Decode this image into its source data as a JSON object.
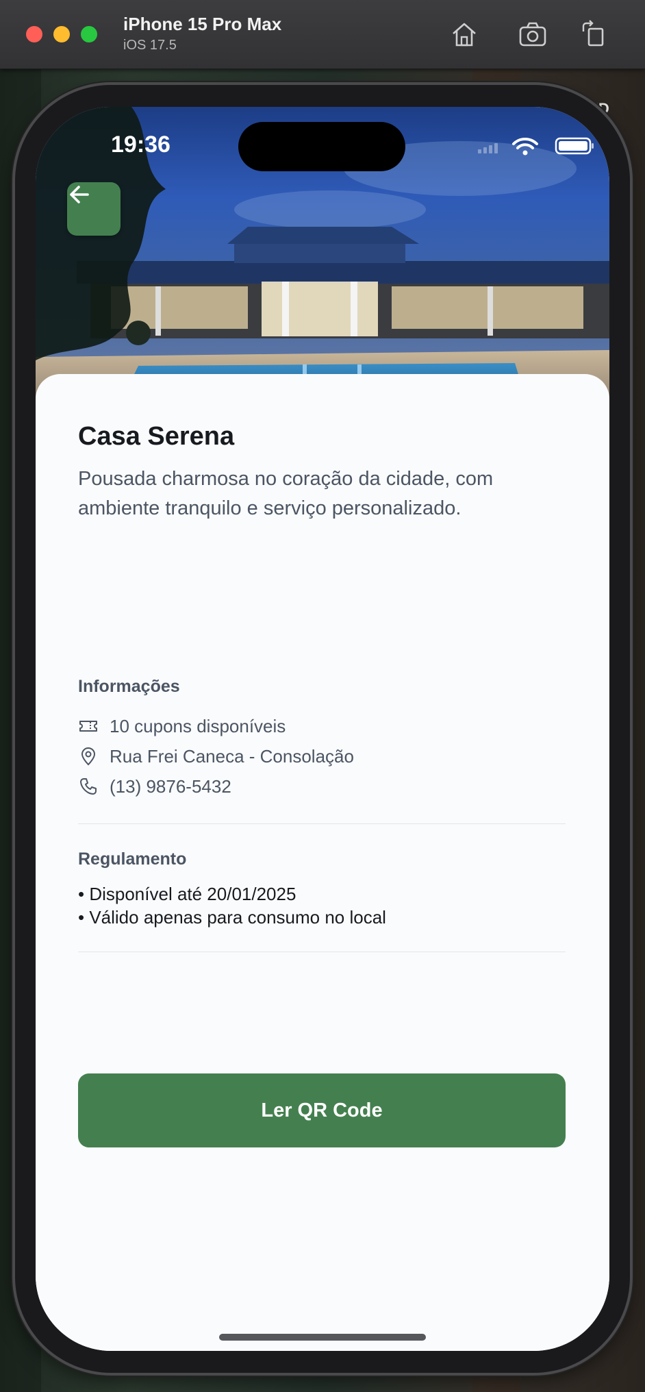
{
  "simulator": {
    "device_name": "iPhone 15 Pro Max",
    "os_version": "iOS 17.5",
    "icons": [
      "home-icon",
      "screenshot-icon",
      "rotate-icon"
    ]
  },
  "background": {
    "badge": "HD"
  },
  "status_bar": {
    "time": "19:36"
  },
  "place": {
    "name": "Casa Serena",
    "description": "Pousada charmosa no coração da cidade, com ambiente tranquilo e serviço personalizado."
  },
  "info": {
    "title": "Informações",
    "coupons": "10 cupons disponíveis",
    "address": "Rua Frei Caneca - Consolação",
    "phone": "(13) 9876-5432"
  },
  "rules": {
    "title": "Regulamento",
    "items": [
      "• Disponível até 20/01/2025",
      "• Válido apenas para consumo no local"
    ]
  },
  "cta": {
    "label": "Ler QR Code"
  },
  "colors": {
    "accent": "#44804f",
    "text_primary": "#171a1f",
    "text_secondary": "#4b5563"
  }
}
